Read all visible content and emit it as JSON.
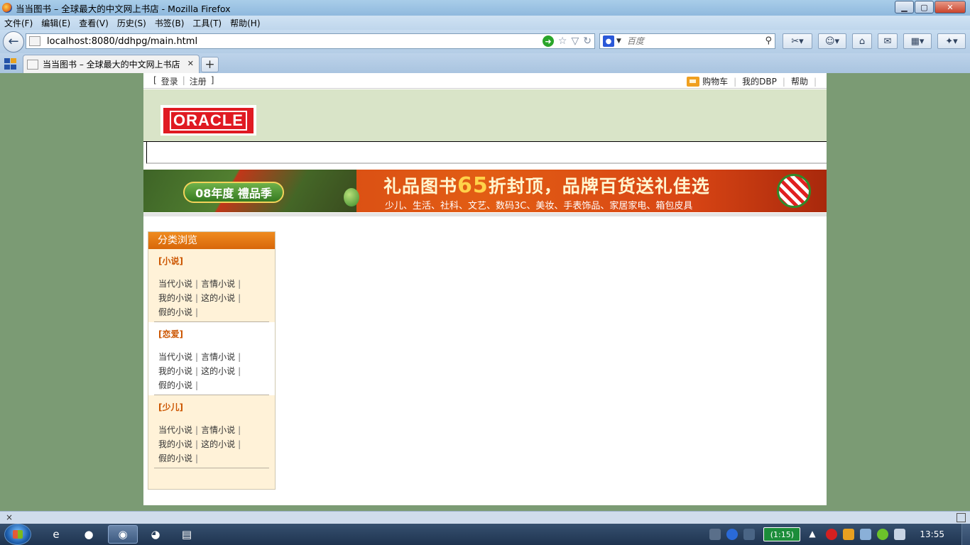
{
  "window": {
    "title": "当当图书 – 全球最大的中文网上书店 - Mozilla Firefox",
    "buttons": {
      "minimize": "▁",
      "maximize": "▢",
      "close": "✕"
    }
  },
  "menu": [
    "文件(F)",
    "编辑(E)",
    "查看(V)",
    "历史(S)",
    "书签(B)",
    "工具(T)",
    "帮助(H)"
  ],
  "navbar": {
    "url": "localhost:8080/ddhpg/main.html",
    "search_placeholder": "百度"
  },
  "tabs": [
    {
      "label": "当当图书 – 全球最大的中文网上书店"
    }
  ],
  "page": {
    "auth": {
      "left_bracket": "[",
      "login": "登录",
      "sep": "|",
      "register": "注册",
      "right_bracket": "]"
    },
    "userlinks": {
      "cart": "购物车",
      "my_account": "我的DBP",
      "help": "帮助"
    },
    "logo": "ORACLE",
    "banner": {
      "badge": "08年度 禮品季",
      "headline_pre": "礼品图书",
      "headline_num": "65",
      "headline_post": "折封顶，品牌百货送礼佳选",
      "subline": "少儿、生活、社科、文艺、数码3C、美妆、手表饰品、家居家电、箱包皮具"
    },
    "sidebar": {
      "header": "分类浏览",
      "categories": [
        {
          "title": "[小说]",
          "rows": [
            [
              "当代小说",
              "言情小说"
            ],
            [
              "我的小说",
              "这的小说"
            ],
            [
              "假的小说"
            ]
          ]
        },
        {
          "title": "[恋爱]",
          "rows": [
            [
              "当代小说",
              "言情小说"
            ],
            [
              "我的小说",
              "这的小说"
            ],
            [
              "假的小说"
            ]
          ]
        },
        {
          "title": "[少儿]",
          "rows": [
            [
              "当代小说",
              "言情小说"
            ],
            [
              "我的小说",
              "这的小说"
            ],
            [
              "假的小说"
            ]
          ]
        }
      ]
    }
  },
  "statusbar": {
    "close": "×"
  },
  "taskbar": {
    "battery": "(1:15)",
    "clock": "13:55"
  },
  "colors": {
    "desktop_bg": "#7b9b74",
    "logo_band": "#d9e4c8",
    "oracle_red": "#e01a22",
    "sidebar_header": "#e0780f",
    "category_title": "#cc5500",
    "sidebar_bg": "#fff2d8"
  },
  "icons": {
    "back": "back-arrow-icon",
    "go": "go-arrow-icon",
    "bookmark": "star-icon",
    "reload": "reload-icon",
    "search": "magnifier-icon",
    "home": "home-icon",
    "cart": "shopping-cart-icon"
  }
}
